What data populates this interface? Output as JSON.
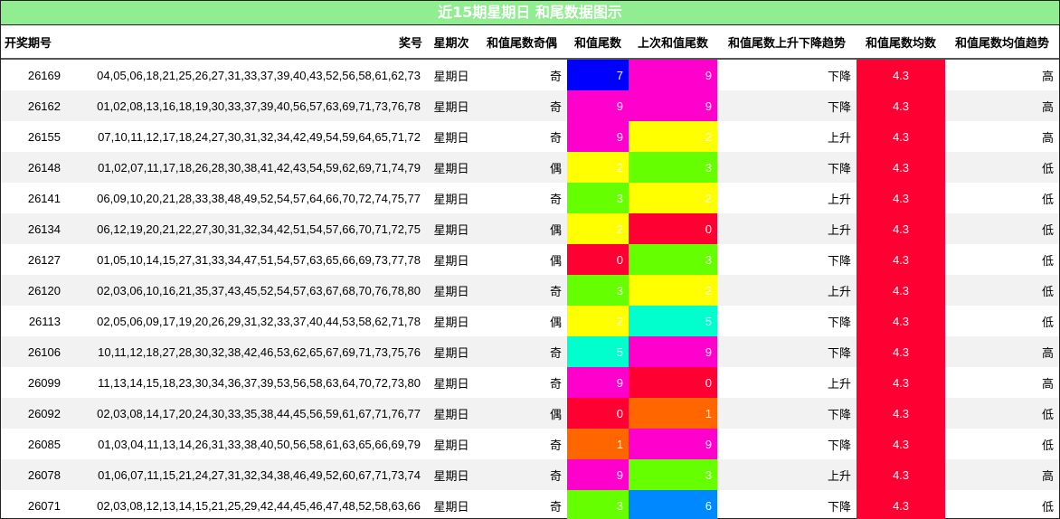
{
  "title": "近15期星期日 和尾数据图示",
  "headers": [
    "开奖期号",
    "奖号",
    "星期次",
    "和值尾数奇偶",
    "和值尾数",
    "上次和值尾数",
    "和值尾数上升下降趋势",
    "和值尾数均数",
    "和值尾数均值趋势"
  ],
  "colors": {
    "0": "#ff0033",
    "1": "#ff6600",
    "2": "#ffff00",
    "3": "#66ff00",
    "5": "#00ffcc",
    "6": "#0088ff",
    "7": "#0000ff",
    "9": "#ff00cc",
    "avg": "#ff0033",
    "title_bg": "#90ee90"
  },
  "rows": [
    {
      "issue": "26169",
      "numbers": "04,05,06,18,21,25,26,27,31,33,37,39,40,43,52,56,58,61,62,73",
      "weekday": "星期日",
      "parity": "奇",
      "sum_tail": "7",
      "last_tail": "9",
      "trend": "下降",
      "avg": "4.3",
      "avg_trend": "高"
    },
    {
      "issue": "26162",
      "numbers": "01,02,08,13,16,18,19,30,33,37,39,40,56,57,63,69,71,73,76,78",
      "weekday": "星期日",
      "parity": "奇",
      "sum_tail": "9",
      "last_tail": "9",
      "trend": "下降",
      "avg": "4.3",
      "avg_trend": "高"
    },
    {
      "issue": "26155",
      "numbers": "07,10,11,12,17,18,24,27,30,31,32,34,42,49,54,59,64,65,71,72",
      "weekday": "星期日",
      "parity": "奇",
      "sum_tail": "9",
      "last_tail": "2",
      "trend": "上升",
      "avg": "4.3",
      "avg_trend": "高"
    },
    {
      "issue": "26148",
      "numbers": "01,02,07,11,17,18,26,28,30,38,41,42,43,54,59,62,69,71,74,79",
      "weekday": "星期日",
      "parity": "偶",
      "sum_tail": "2",
      "last_tail": "3",
      "trend": "下降",
      "avg": "4.3",
      "avg_trend": "低"
    },
    {
      "issue": "26141",
      "numbers": "06,09,10,20,21,28,33,38,48,49,52,54,57,64,66,70,72,74,75,77",
      "weekday": "星期日",
      "parity": "奇",
      "sum_tail": "3",
      "last_tail": "2",
      "trend": "上升",
      "avg": "4.3",
      "avg_trend": "低"
    },
    {
      "issue": "26134",
      "numbers": "06,12,19,20,21,22,27,30,31,32,34,42,51,54,57,66,70,71,72,75",
      "weekday": "星期日",
      "parity": "偶",
      "sum_tail": "2",
      "last_tail": "0",
      "trend": "上升",
      "avg": "4.3",
      "avg_trend": "低"
    },
    {
      "issue": "26127",
      "numbers": "01,05,10,14,15,27,31,33,34,47,51,54,57,63,65,66,69,73,77,78",
      "weekday": "星期日",
      "parity": "偶",
      "sum_tail": "0",
      "last_tail": "3",
      "trend": "下降",
      "avg": "4.3",
      "avg_trend": "低"
    },
    {
      "issue": "26120",
      "numbers": "02,03,06,10,16,21,35,37,43,45,52,54,57,63,67,68,70,76,78,80",
      "weekday": "星期日",
      "parity": "奇",
      "sum_tail": "3",
      "last_tail": "2",
      "trend": "上升",
      "avg": "4.3",
      "avg_trend": "低"
    },
    {
      "issue": "26113",
      "numbers": "02,05,06,09,17,19,20,26,29,31,32,33,37,40,44,53,58,62,71,78",
      "weekday": "星期日",
      "parity": "偶",
      "sum_tail": "2",
      "last_tail": "5",
      "trend": "下降",
      "avg": "4.3",
      "avg_trend": "低"
    },
    {
      "issue": "26106",
      "numbers": "10,11,12,18,27,28,30,32,38,42,46,53,62,65,67,69,71,73,75,76",
      "weekday": "星期日",
      "parity": "奇",
      "sum_tail": "5",
      "last_tail": "9",
      "trend": "下降",
      "avg": "4.3",
      "avg_trend": "高"
    },
    {
      "issue": "26099",
      "numbers": "11,13,14,15,18,23,30,34,36,37,39,53,56,58,63,64,70,72,73,80",
      "weekday": "星期日",
      "parity": "奇",
      "sum_tail": "9",
      "last_tail": "0",
      "trend": "上升",
      "avg": "4.3",
      "avg_trend": "高"
    },
    {
      "issue": "26092",
      "numbers": "02,03,08,14,17,20,24,30,33,35,38,44,45,56,59,61,67,71,76,77",
      "weekday": "星期日",
      "parity": "偶",
      "sum_tail": "0",
      "last_tail": "1",
      "trend": "下降",
      "avg": "4.3",
      "avg_trend": "低"
    },
    {
      "issue": "26085",
      "numbers": "01,03,04,11,13,14,26,31,33,38,40,50,56,58,61,63,65,66,69,79",
      "weekday": "星期日",
      "parity": "奇",
      "sum_tail": "1",
      "last_tail": "9",
      "trend": "下降",
      "avg": "4.3",
      "avg_trend": "低"
    },
    {
      "issue": "26078",
      "numbers": "01,06,07,11,15,21,24,27,31,32,34,38,46,49,52,60,67,71,73,74",
      "weekday": "星期日",
      "parity": "奇",
      "sum_tail": "9",
      "last_tail": "3",
      "trend": "上升",
      "avg": "4.3",
      "avg_trend": "高"
    },
    {
      "issue": "26071",
      "numbers": "02,03,08,12,13,14,15,21,25,29,42,44,45,46,47,48,52,58,63,66",
      "weekday": "星期日",
      "parity": "奇",
      "sum_tail": "3",
      "last_tail": "6",
      "trend": "下降",
      "avg": "4.3",
      "avg_trend": "低"
    }
  ]
}
